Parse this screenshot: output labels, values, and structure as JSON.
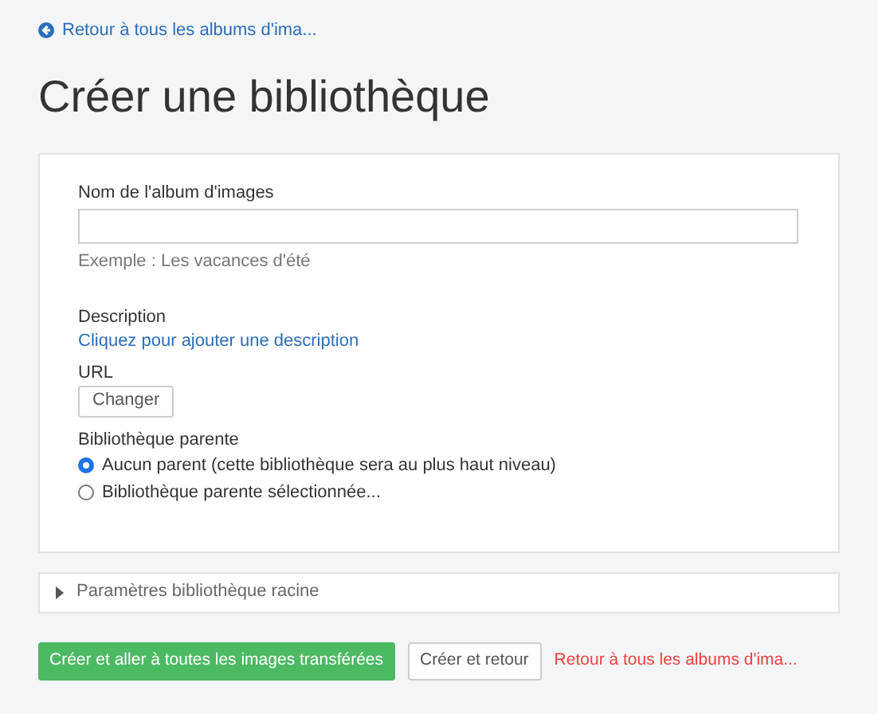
{
  "back_link": "Retour à tous les albums d'ima...",
  "title": "Créer une bibliothèque",
  "form": {
    "name_label": "Nom de l'album d'images",
    "name_hint": "Exemple : Les vacances d'été",
    "description_label": "Description",
    "description_link": "Cliquez pour ajouter une description",
    "url_label": "URL",
    "url_button": "Changer",
    "parent_label": "Bibliothèque parente",
    "parent_options": [
      {
        "label": "Aucun parent (cette bibliothèque sera au plus haut niveau)",
        "selected": true
      },
      {
        "label": "Bibliothèque parente sélectionnée...",
        "selected": false
      }
    ]
  },
  "root_settings": {
    "label": "Paramètres bibliothèque racine",
    "expanded": false
  },
  "actions": {
    "primary": "Créer et aller à toutes les images transférées",
    "secondary": "Créer et retour",
    "cancel": "Retour à tous les albums d'ima..."
  }
}
